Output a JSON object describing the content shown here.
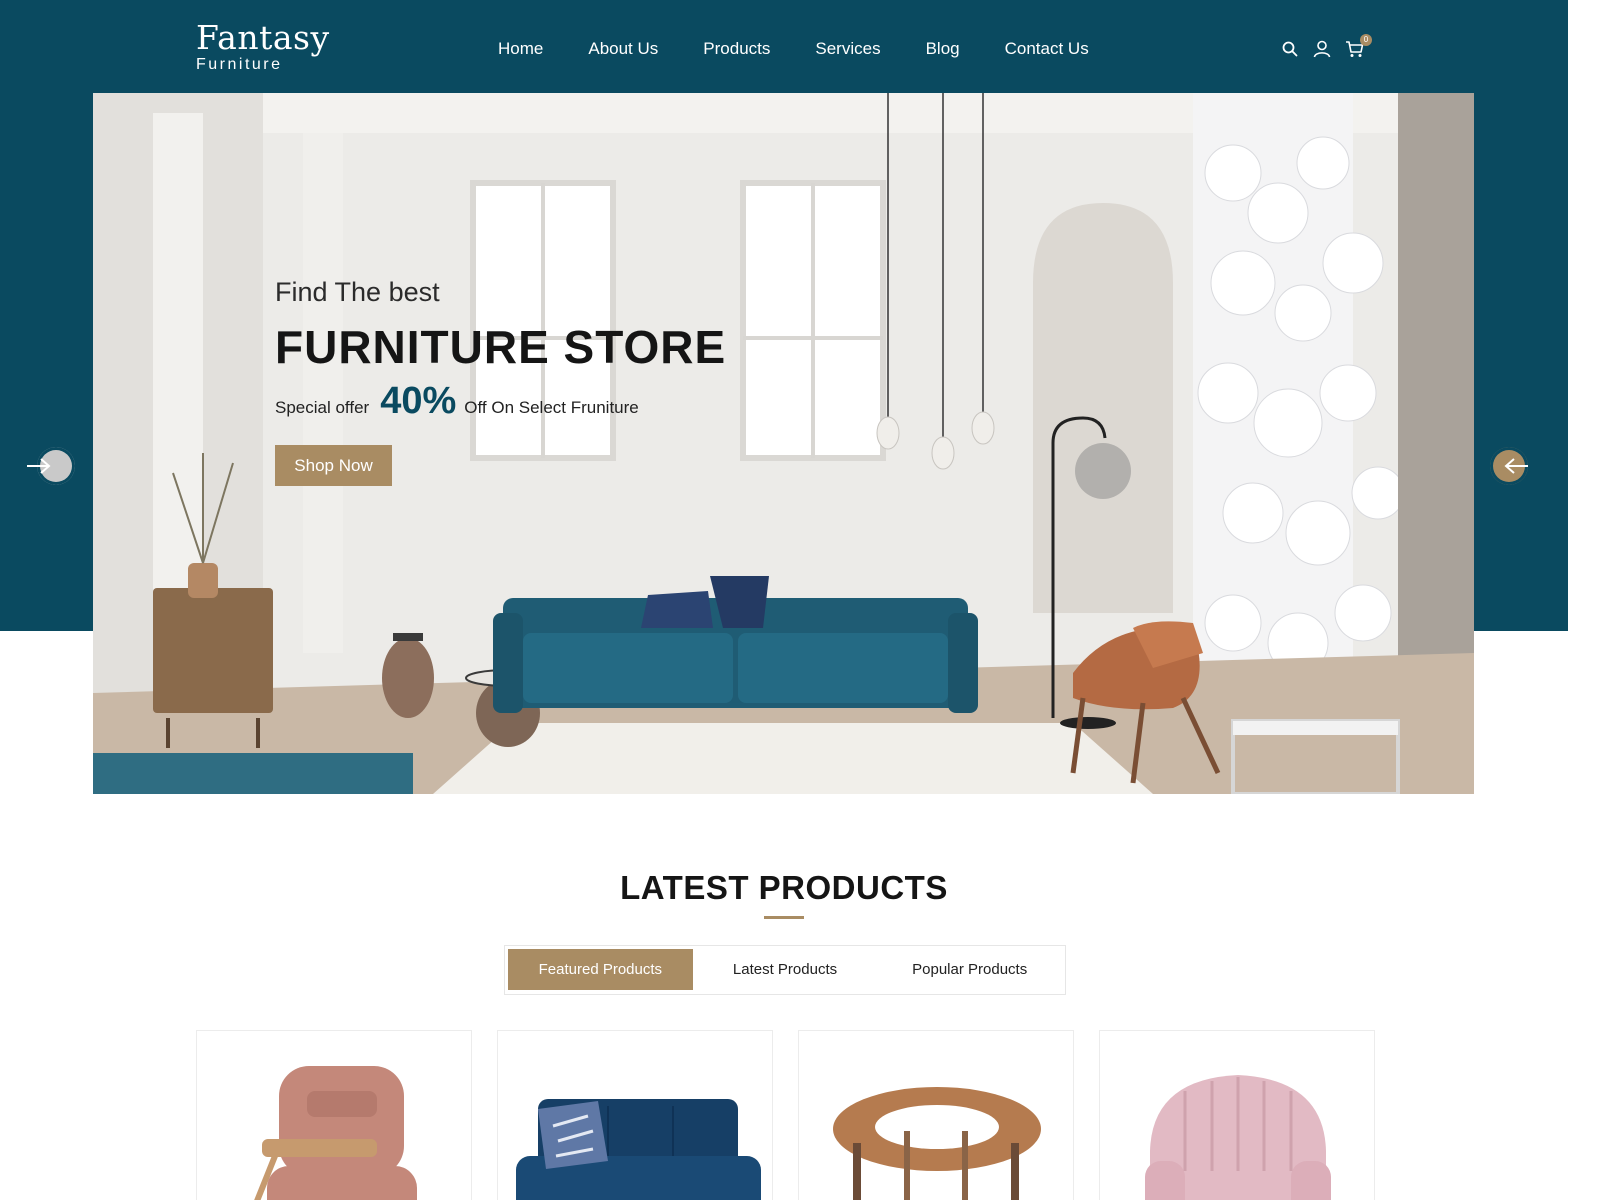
{
  "brand": {
    "name": "Fantasy",
    "tagline": "Furniture"
  },
  "nav": {
    "items": [
      {
        "label": "Home"
      },
      {
        "label": "About Us"
      },
      {
        "label": "Products"
      },
      {
        "label": "Services"
      },
      {
        "label": "Blog"
      },
      {
        "label": "Contact Us"
      }
    ]
  },
  "header_icons": {
    "search": "search-icon",
    "account": "user-icon",
    "cart": "cart-icon",
    "cart_count": "0"
  },
  "hero": {
    "kicker": "Find The best",
    "title": "FURNITURE STORE",
    "offer_label": "Special offer",
    "offer_percent": "40%",
    "offer_rest": "Off On Select Fruniture",
    "cta": "Shop Now",
    "prev_icon": "arrow-left-icon",
    "next_icon": "arrow-left-icon"
  },
  "products": {
    "title": "LATEST PRODUCTS",
    "tabs": [
      {
        "label": "Featured Products",
        "active": true
      },
      {
        "label": "Latest Products",
        "active": false
      },
      {
        "label": "Popular Products",
        "active": false
      }
    ],
    "items": [
      {
        "image": "pink-lounge-chair"
      },
      {
        "image": "navy-loveseat"
      },
      {
        "image": "round-wood-side-table"
      },
      {
        "image": "blush-shell-armchair"
      }
    ]
  },
  "colors": {
    "primary": "#0a4a60",
    "accent": "#a98c63",
    "text": "#151515"
  }
}
